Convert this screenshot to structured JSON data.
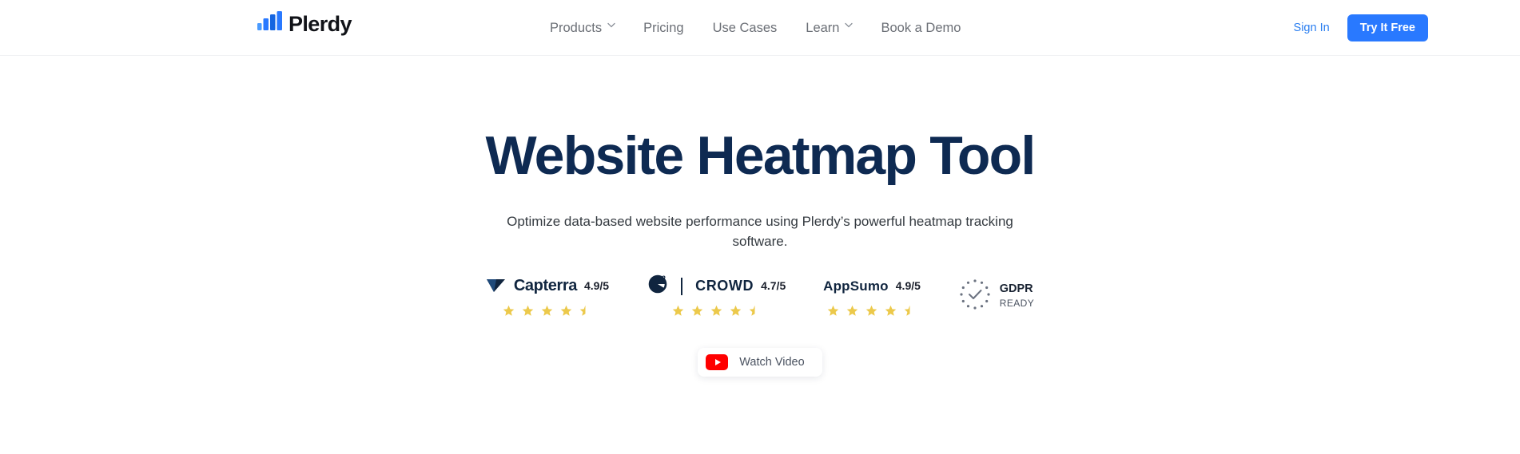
{
  "brand": {
    "name": "Plerdy",
    "flag_alt": "ukraine-flag",
    "logo_color": "#2979ff"
  },
  "nav": {
    "items": [
      {
        "label": "Products",
        "has_dropdown": true
      },
      {
        "label": "Pricing",
        "has_dropdown": false
      },
      {
        "label": "Use Cases",
        "has_dropdown": false
      },
      {
        "label": "Learn",
        "has_dropdown": true
      },
      {
        "label": "Book a Demo",
        "has_dropdown": false
      }
    ],
    "sign_in": "Sign In",
    "cta": "Try It Free",
    "cta_color": "#2979ff",
    "link_color": "#2a7ef0"
  },
  "hero": {
    "title": "Website Heatmap Tool",
    "title_color": "#0e2a52",
    "subtitle": "Optimize data-based website performance using Plerdy’s powerful heatmap tracking software."
  },
  "badges": [
    {
      "id": "capterra",
      "wordmark": "Capterra",
      "score": "4.9/5",
      "score_inline": true,
      "stars_full": 4,
      "stars_half": 1,
      "star_color": "#ecc94b"
    },
    {
      "id": "g2crowd",
      "wordmark": "CROWD",
      "score": "4.7/5",
      "score_inline": false,
      "stars_full": 4,
      "stars_half": 1,
      "star_color": "#ecc94b"
    },
    {
      "id": "appsumo",
      "wordmark": "AppSumo",
      "score": "4.9/5",
      "score_inline": false,
      "stars_full": 4,
      "stars_half": 1,
      "star_color": "#ecc94b"
    }
  ],
  "gdpr": {
    "main": "GDPR",
    "sub": "READY"
  },
  "watch_video": {
    "label": "Watch Video",
    "icon": "youtube-icon",
    "icon_color": "#ff0000"
  }
}
